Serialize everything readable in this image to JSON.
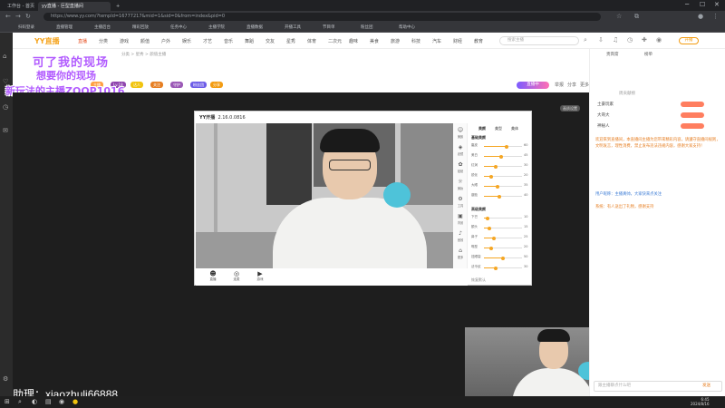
{
  "browser": {
    "tabs": [
      {
        "label": "工作台 - 首页"
      },
      {
        "label": "yy直播 - 巨型直播间"
      }
    ],
    "new_tab": "+",
    "url": "https://www.yy.com/?tempId=16777217&mid=1&sid=0&from=index&pid=0",
    "bookmarks": [
      "扫码登录",
      "直播管理",
      "主播后台",
      "精彩回放",
      "任务中心",
      "主播学院",
      "直播数据",
      "开播工具",
      "节目单",
      "粉丝团",
      "帮助中心"
    ],
    "controls": {
      "minimize": "─",
      "maximize": "☐",
      "close": "✕"
    }
  },
  "site": {
    "logo": "YY直播",
    "nav": [
      "直播",
      "分类",
      "游戏",
      "颜值",
      "户外",
      "娱乐",
      "才艺",
      "音乐",
      "舞蹈",
      "交友",
      "星秀",
      "体育",
      "二次元",
      "趣味",
      "美食",
      "旅游",
      "科技",
      "汽车",
      "财经",
      "教育"
    ],
    "hot_nav": "直播",
    "search_placeholder": "搜索主播",
    "action_button": "开播",
    "categories_line": "分类 > 星秀 > 颜值主播",
    "badges": [
      {
        "label": "主播",
        "color": "#ff9f43"
      },
      {
        "label": "Lv.18",
        "color": "#8e44ad"
      },
      {
        "label": "达人",
        "color": "#f1c40f"
      },
      {
        "label": "关注",
        "color": "#e67e22"
      },
      {
        "label": "守护",
        "color": "#9b59b6"
      },
      {
        "label": "粉丝团",
        "color": "#6c5ce7"
      },
      {
        "label": "分享",
        "color": "#f39c12"
      }
    ],
    "live_tag": "直播中",
    "room_controls": [
      "举报",
      "分享",
      "更多"
    ]
  },
  "overlay": {
    "line1": "可了我的现场",
    "line2": "想要你的现场",
    "line3": "新玩法的主播ZOOP1016"
  },
  "player": {
    "tag": "画质设置",
    "watermark": "助理：xiaozhuli66888"
  },
  "yy_window": {
    "title": "YY开播",
    "version": "2.16.0.0816",
    "rail": [
      {
        "icon": "☺",
        "label": "美颜"
      },
      {
        "icon": "◈",
        "label": "滤镜"
      },
      {
        "icon": "✿",
        "label": "贴纸"
      },
      {
        "icon": "☼",
        "label": "美妆"
      },
      {
        "icon": "⚙",
        "label": "工具"
      },
      {
        "icon": "▣",
        "label": "背景"
      },
      {
        "icon": "♪",
        "label": "音效"
      },
      {
        "icon": "⌂",
        "label": "更多"
      }
    ],
    "panel_sections": [
      "基础美颜",
      "高级美颜"
    ],
    "panel_tabs": [
      "美颜",
      "美型",
      "美体"
    ],
    "sliders": [
      {
        "label": "磨皮",
        "value": 60
      },
      {
        "label": "美白",
        "value": 45
      },
      {
        "label": "红润",
        "value": 30
      },
      {
        "label": "锐化",
        "value": 20
      },
      {
        "label": "大眼",
        "value": 35
      },
      {
        "label": "瘦脸",
        "value": 40
      },
      {
        "label": "下巴",
        "value": 10
      },
      {
        "label": "额头",
        "value": 15
      },
      {
        "label": "鼻子",
        "value": 25
      },
      {
        "label": "嘴型",
        "value": 20
      },
      {
        "label": "祛眼袋",
        "value": 50
      },
      {
        "label": "法令纹",
        "value": 30
      }
    ],
    "bottom_buttons": [
      {
        "icon": "☻",
        "label": "直播"
      },
      {
        "icon": "◎",
        "label": "连麦"
      },
      {
        "icon": "▶",
        "label": "游戏"
      }
    ],
    "reset_label": "恢复默认"
  },
  "right_panel": {
    "tabs": [
      "贵宾席",
      "榜单"
    ],
    "rank_title": "周贡献榜",
    "rank_items": [
      "土豪玩家",
      "大哥大",
      "神秘人"
    ],
    "chat": [
      {
        "text": "欢迎来到直播间，本直播间主播为您带来精彩内容，请遵守直播间规则，文明发言，理性消费，禁止发布违法违规内容，感谢大家支持！",
        "color": "orange"
      },
      {
        "text": "用户昵称：主播真帅，大家快来点关注",
        "color": "blue"
      },
      {
        "text": "系统：有人送出了礼物，感谢支持",
        "color": "orange"
      }
    ],
    "chat_placeholder": "跟主播聊点什么吧",
    "send_label": "发送"
  },
  "taskbar": {
    "time": "6:45",
    "date": "2024/8/16"
  }
}
